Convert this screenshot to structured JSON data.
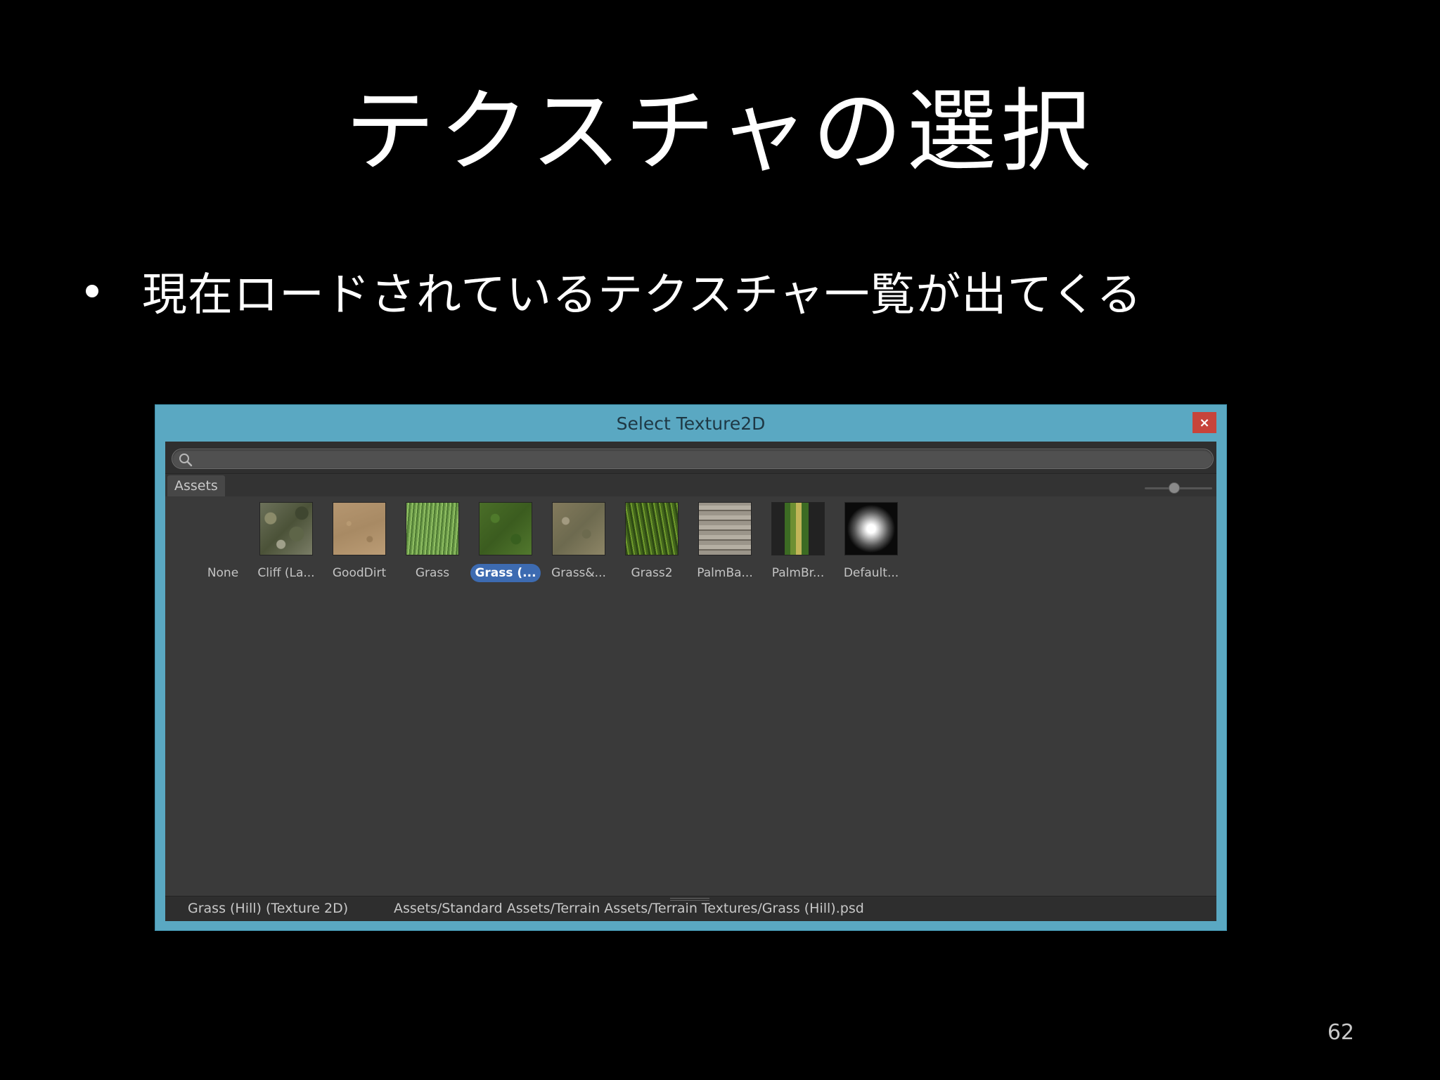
{
  "slide": {
    "title": "テクスチャの選択",
    "bullet": "現在ロードされているテクスチャ一覧が出てくる",
    "page_number": "62"
  },
  "dialog": {
    "title": "Select Texture2D",
    "close_label": "×",
    "search": {
      "value": "",
      "placeholder": ""
    },
    "tab_label": "Assets",
    "zoom_level": 0.4,
    "items": [
      {
        "label": "None",
        "texture": "none"
      },
      {
        "label": "Cliff (La...",
        "texture": "cliff"
      },
      {
        "label": "GoodDirt",
        "texture": "dirt"
      },
      {
        "label": "Grass",
        "texture": "grass"
      },
      {
        "label": "Grass (...",
        "texture": "grass-hill",
        "selected": true
      },
      {
        "label": "Grass&...",
        "texture": "grass-rock"
      },
      {
        "label": "Grass2",
        "texture": "grass2"
      },
      {
        "label": "PalmBa...",
        "texture": "palm-bark"
      },
      {
        "label": "PalmBr...",
        "texture": "palm-branch"
      },
      {
        "label": "Default...",
        "texture": "default-particle"
      }
    ],
    "status": {
      "name": "Grass (Hill) (Texture 2D)",
      "path": "Assets/Standard Assets/Terrain Assets/Terrain Textures/Grass (Hill).psd"
    }
  },
  "colors": {
    "window_frame": "#5aa8c2",
    "close_button": "#c7443b",
    "panel_background": "#3a3a3a",
    "selection": "#3d6bb1"
  }
}
